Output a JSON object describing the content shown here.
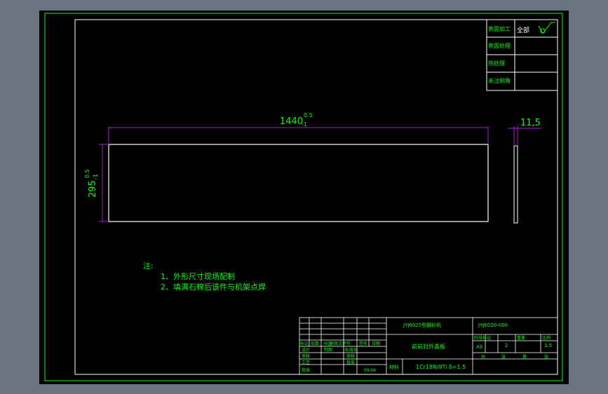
{
  "colors": {
    "background": "#000000",
    "frame": "#00ff00",
    "outline": "#ffffff",
    "dimension": "#a020d0",
    "dimension_text": "#00ff00",
    "note_text": "#00ff00",
    "table_text": "#00ff00"
  },
  "dimensions": {
    "length": "1440",
    "length_tol_upper": "0.5",
    "length_tol_lower": "-1",
    "width": "295",
    "width_tol_upper": "0.5",
    "width_tol_lower": "-1",
    "thickness": "11,5"
  },
  "roughness_table": {
    "rows": [
      {
        "label": "表面加工",
        "value": "全部"
      },
      {
        "label": "表面处理",
        "value": ""
      },
      {
        "label": "热处理",
        "value": ""
      },
      {
        "label": "未注倒角",
        "value": ""
      }
    ]
  },
  "notes": {
    "title": "注:",
    "items": [
      "1、外形尺寸现场配制",
      "2、填满石棉后该件与机架点焊"
    ]
  },
  "title_block": {
    "project": "JYJ6025型翻砂机",
    "drawing_no": "JYJ6020-000",
    "part_name": "前前封外盖板",
    "material_label": "材料",
    "material": "1Cr18Ni9Ti δ=1.5",
    "headers_left": [
      "标记",
      "处数",
      "分区",
      "更改文件号",
      "签名",
      "日期"
    ],
    "role_labels": [
      "设计",
      "制图",
      "审核",
      "工艺",
      "批准"
    ],
    "role_labels2": [
      "标准化",
      "审核",
      "批准"
    ],
    "headers_right": [
      "阶段标记",
      "重量",
      "比例"
    ],
    "stage": "A3",
    "count": "2",
    "scale": "1:5",
    "sheet_labels": [
      "共",
      "张",
      "第",
      "张"
    ],
    "date": "09.06"
  }
}
